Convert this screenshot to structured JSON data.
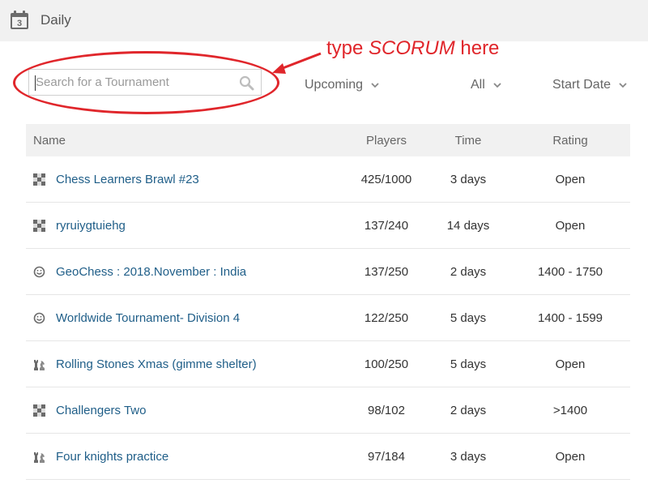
{
  "header": {
    "title": "Daily",
    "calendar_day": "3"
  },
  "search": {
    "placeholder": "Search for a Tournament",
    "value": ""
  },
  "annotation": {
    "prefix": "type ",
    "keyword": "SCORUM",
    "suffix": " here",
    "color": "#e0262b"
  },
  "filters": {
    "status": "Upcoming",
    "type": "All",
    "sort": "Start Date"
  },
  "table": {
    "columns": {
      "name": "Name",
      "players": "Players",
      "time": "Time",
      "rating": "Rating"
    },
    "rows": [
      {
        "icon": "chessboard-icon",
        "name": "Chess Learners Brawl #23",
        "players": "425/1000",
        "time": "3 days",
        "rating": "Open"
      },
      {
        "icon": "chessboard-icon",
        "name": "ryruiygtuiehg",
        "players": "137/240",
        "time": "14 days",
        "rating": "Open"
      },
      {
        "icon": "smiley-icon",
        "name": "GeoChess : 2018.November : India",
        "players": "137/250",
        "time": "2 days",
        "rating": "1400 - 1750"
      },
      {
        "icon": "smiley-icon",
        "name": "Worldwide Tournament- Division 4",
        "players": "122/250",
        "time": "5 days",
        "rating": "1400 - 1599"
      },
      {
        "icon": "rook-knight-icon",
        "name": "Rolling Stones Xmas (gimme shelter)",
        "players": "100/250",
        "time": "5 days",
        "rating": "Open"
      },
      {
        "icon": "chessboard-icon",
        "name": "Challengers Two",
        "players": "98/102",
        "time": "2 days",
        "rating": ">1400"
      },
      {
        "icon": "rook-knight-icon",
        "name": "Four knights practice",
        "players": "97/184",
        "time": "3 days",
        "rating": "Open"
      }
    ]
  },
  "colors": {
    "link": "#1f5e88",
    "header_bg": "#f1f1f1",
    "annotation": "#e0262b"
  }
}
